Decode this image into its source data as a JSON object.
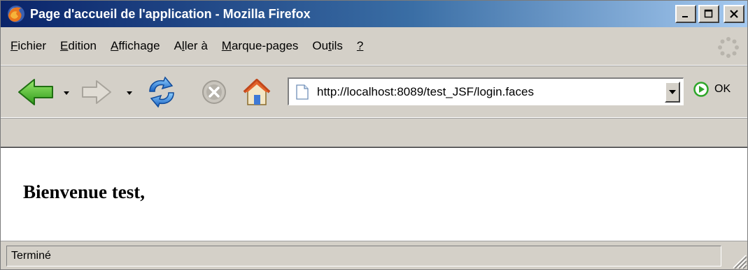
{
  "window": {
    "title": "Page d'accueil de l'application - Mozilla Firefox",
    "controls": {
      "minimize": "_",
      "maximize": "□",
      "close": "X"
    }
  },
  "menu": {
    "items": [
      {
        "label": "Fichier",
        "accesskey_index": 0
      },
      {
        "label": "Edition",
        "accesskey_index": 0
      },
      {
        "label": "Affichage",
        "accesskey_index": 0
      },
      {
        "label": "Aller à",
        "accesskey_index": 1
      },
      {
        "label": "Marque-pages",
        "accesskey_index": 0
      },
      {
        "label": "Outils",
        "accesskey_index": 2
      },
      {
        "label": "?",
        "accesskey_index": 0
      }
    ]
  },
  "navigation": {
    "back_icon": "back-arrow-icon",
    "forward_icon": "forward-arrow-icon",
    "reload_icon": "reload-icon",
    "stop_icon": "stop-icon",
    "home_icon": "home-icon",
    "url": "http://localhost:8089/test_JSF/login.faces",
    "go_label": "OK"
  },
  "page": {
    "heading": "Bienvenue test,"
  },
  "status": {
    "text": "Terminé"
  },
  "colors": {
    "title_gradient_start": "#0a246a",
    "title_gradient_end": "#a6caf0",
    "chrome": "#d4d0c8",
    "nav_green": "#3fbf2a",
    "reload_blue": "#2a7fd4"
  }
}
